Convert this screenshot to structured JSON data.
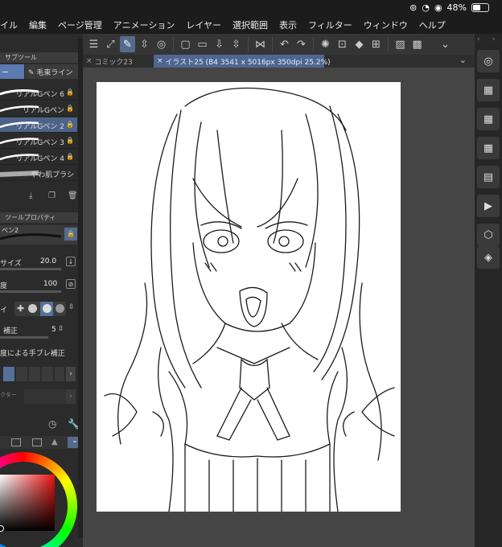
{
  "status": {
    "battery": "48%"
  },
  "menu": {
    "items": [
      "イル",
      "編集",
      "ページ管理",
      "アニメーション",
      "レイヤー",
      "選択範囲",
      "表示",
      "フィルター",
      "ウィンドウ",
      "ヘルプ"
    ]
  },
  "tabs": [
    {
      "label": "コミック23",
      "close": "×",
      "active": false
    },
    {
      "label": "イラスト25 (B4 3541 x 5016px 350dpi 25.2%)",
      "close": "×",
      "active": true
    }
  ],
  "left_panel": {
    "subtool_header": "サブツール",
    "subtool_tabs": [
      "ー",
      "毛束ライン"
    ],
    "brushes": [
      {
        "name": "リアルGペン 6",
        "locked": true,
        "selected": false
      },
      {
        "name": "リアルGペン",
        "locked": true,
        "selected": false
      },
      {
        "name": "リアルGペン 2",
        "locked": true,
        "selected": true
      },
      {
        "name": "リアルGペン 3",
        "locked": true,
        "selected": false
      },
      {
        "name": "リアルGペン 4",
        "locked": true,
        "selected": false
      },
      {
        "name": "やわ肌ブラシ",
        "locked": false,
        "selected": false
      }
    ],
    "tool_property_header": "ツールプロパティ",
    "current_brush": "ペン2",
    "props": {
      "size_label": "サイズ",
      "size_value": "20.0",
      "opacity_label": "度",
      "opacity_value": "100",
      "shape_label": "イ",
      "stabilizer_label": "補正",
      "stabilizer_value": "5",
      "speed_label": "度による手ブレ補正",
      "vector_label": "クター"
    }
  },
  "icons": {
    "toolbar": [
      "menu-icon",
      "resize-icon",
      "draw-mode-icon",
      "chevron-updown-icon",
      "target-icon",
      "new-page-icon",
      "folder-icon",
      "save-icon",
      "chevron-updown-icon",
      "flip-icon",
      "undo-icon",
      "redo-icon",
      "gear-icon",
      "clear-icon",
      "fill-icon",
      "transform-icon",
      "select-all-icon",
      "deselect-icon"
    ],
    "right_panel": [
      "navigator-icon",
      "layer-panel-icon",
      "material-icon",
      "timeline-icon",
      "layer-property-icon",
      "animation-icon",
      "3d-icon",
      "layers-icon"
    ]
  },
  "colors": {
    "accent": "#4f6690",
    "selected_row": "#4d6388",
    "canvas_bg": "#454545",
    "paper": "#ffffff",
    "primary_color": "#c42a2a"
  }
}
